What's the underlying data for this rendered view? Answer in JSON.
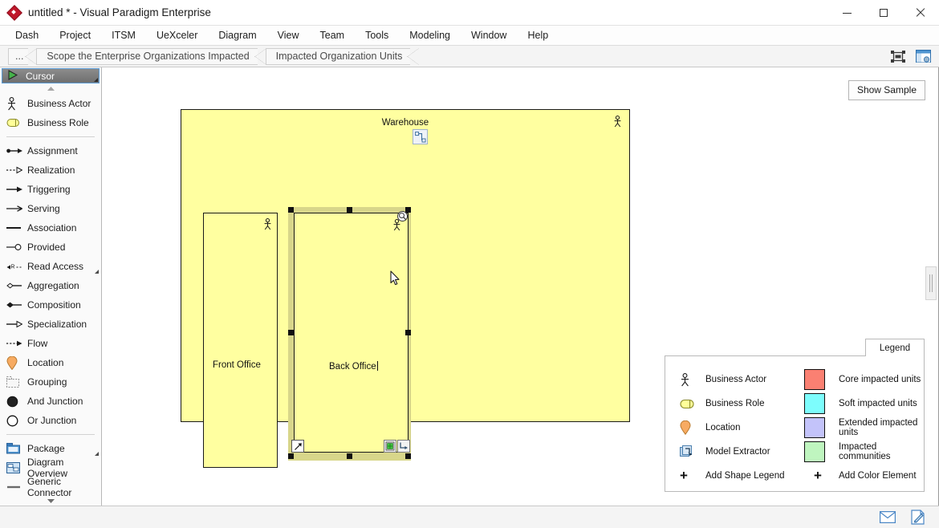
{
  "window": {
    "title": "untitled * - Visual Paradigm Enterprise",
    "logo_icon": "visual-paradigm-diamond-logo",
    "minimize_icon": "minimize-icon",
    "maximize_icon": "maximize-icon",
    "close_icon": "close-icon"
  },
  "menubar": {
    "items": [
      {
        "label": "Dash"
      },
      {
        "label": "Project"
      },
      {
        "label": "ITSM"
      },
      {
        "label": "UeXceler"
      },
      {
        "label": "Diagram"
      },
      {
        "label": "View"
      },
      {
        "label": "Team"
      },
      {
        "label": "Tools"
      },
      {
        "label": "Modeling"
      },
      {
        "label": "Window"
      },
      {
        "label": "Help"
      }
    ]
  },
  "breadcrumb": {
    "items": [
      {
        "label": "..."
      },
      {
        "label": "Scope the Enterprise Organizations Impacted"
      },
      {
        "label": "Impacted Organization Units"
      }
    ],
    "tools": [
      {
        "icon": "fit-to-screen-icon"
      },
      {
        "icon": "open-in-window-icon"
      }
    ]
  },
  "palette": {
    "cursor": {
      "label": "Cursor",
      "icon": "cursor-arrow-icon"
    },
    "scroll_up_icon": "scroll-up-arrow-icon",
    "scroll_down_icon": "scroll-down-arrow-icon",
    "group1": [
      {
        "label": "Business Actor",
        "icon": "business-actor-icon"
      },
      {
        "label": "Business Role",
        "icon": "business-role-icon"
      }
    ],
    "group2": [
      {
        "label": "Assignment",
        "icon": "assignment-connector-icon"
      },
      {
        "label": "Realization",
        "icon": "realization-connector-icon"
      },
      {
        "label": "Triggering",
        "icon": "triggering-connector-icon"
      },
      {
        "label": "Serving",
        "icon": "serving-connector-icon"
      },
      {
        "label": "Association",
        "icon": "association-connector-icon"
      },
      {
        "label": "Provided",
        "icon": "provided-interface-icon"
      },
      {
        "label": "Read Access",
        "icon": "read-access-connector-icon",
        "has_submenu": true
      },
      {
        "label": "Aggregation",
        "icon": "aggregation-connector-icon"
      },
      {
        "label": "Composition",
        "icon": "composition-connector-icon"
      },
      {
        "label": "Specialization",
        "icon": "specialization-connector-icon"
      },
      {
        "label": "Flow",
        "icon": "flow-connector-icon"
      },
      {
        "label": "Location",
        "icon": "location-pin-icon"
      },
      {
        "label": "Grouping",
        "icon": "grouping-icon"
      },
      {
        "label": "And Junction",
        "icon": "and-junction-icon"
      },
      {
        "label": "Or Junction",
        "icon": "or-junction-icon"
      }
    ],
    "group3": [
      {
        "label": "Package",
        "icon": "package-folder-icon",
        "has_submenu": true
      },
      {
        "label": "Diagram Overview",
        "icon": "diagram-overview-icon"
      },
      {
        "label": "Generic Connector",
        "icon": "generic-connector-icon"
      }
    ]
  },
  "canvas": {
    "show_sample_label": "Show Sample",
    "warehouse": {
      "label": "Warehouse",
      "actor_icon": "business-actor-icon",
      "fill_color": "#FFFFA0",
      "border_color": "#1A1A1A"
    },
    "units": [
      {
        "label": "Front Office",
        "actor_icon": "business-actor-icon",
        "fill_color": "#FFFFA0",
        "selected": false
      },
      {
        "label": "Back Office",
        "actor_icon": "business-actor-icon",
        "fill_color": "#FFFFA0",
        "selected": true,
        "editing": true
      }
    ],
    "floating_tool_icon": "resource-catalog-icon",
    "selection_icons": [
      {
        "icon": "resize-arrow-icon"
      },
      {
        "icon": "nested-element-icon"
      },
      {
        "icon": "quick-connect-icon"
      }
    ],
    "mouse_cursor_icon": "mouse-pointer-icon",
    "splitter_icon": "vertical-splitter-handle"
  },
  "legend": {
    "tab_label": "Legend",
    "shapes": [
      {
        "label": "Business Actor",
        "icon": "business-actor-icon"
      },
      {
        "label": "Business Role",
        "icon": "business-role-icon"
      },
      {
        "label": "Location",
        "icon": "location-pin-icon"
      },
      {
        "label": "Model Extractor",
        "icon": "model-extractor-icon"
      }
    ],
    "add_shape_label": "Add Shape Legend",
    "add_shape_icon": "plus-icon",
    "colors": [
      {
        "label": "Core impacted units",
        "color": "#FA8072"
      },
      {
        "label": "Soft impacted units",
        "color": "#7DFDFD"
      },
      {
        "label": "Extended impacted units",
        "color": "#C3C3FA"
      },
      {
        "label": "Impacted communities",
        "color": "#BFF5BF"
      }
    ],
    "add_color_label": "Add Color Element",
    "add_color_icon": "plus-icon"
  },
  "statusbar": {
    "buttons": [
      {
        "icon": "message-envelope-icon"
      },
      {
        "icon": "edit-note-icon"
      }
    ]
  }
}
